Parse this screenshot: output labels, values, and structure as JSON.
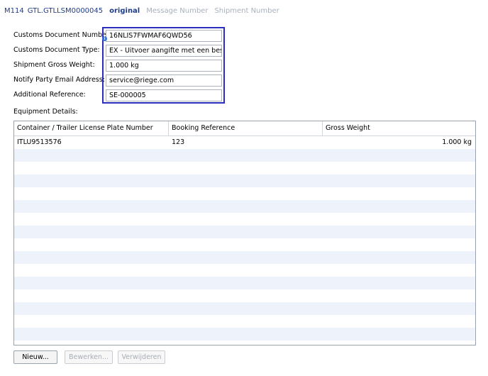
{
  "header": {
    "id": "M114",
    "doc_number": "GTL.GTLLSM0000045",
    "status": "original",
    "link_message": "Message Number",
    "link_shipment": "Shipment Number"
  },
  "form": {
    "customs_doc_number_label": "Customs Document Number:",
    "customs_doc_number_value": "16NLIS7FWMAF6QWD56",
    "customs_doc_type_label": "Customs Document Type:",
    "customs_doc_type_value": "EX - Uitvoer aangifte met een bestemm",
    "gross_weight_label": "Shipment Gross Weight:",
    "gross_weight_value": "1.000 kg",
    "notify_email_label": "Notify Party Email Address:",
    "notify_email_value": "service@riege.com",
    "additional_ref_label": "Additional Reference:",
    "additional_ref_value": "SE-000005"
  },
  "equipment": {
    "label": "Equipment Details:",
    "columns": [
      "Container / Trailer License Plate Number",
      "Booking Reference",
      "Gross Weight"
    ],
    "rows": [
      {
        "plate": "ITLU9513576",
        "booking": "123",
        "weight": "1.000 kg"
      }
    ]
  },
  "buttons": {
    "new": "Nieuw...",
    "edit": "Bewerken...",
    "delete": "Verwijderen"
  },
  "colors": {
    "accent_text": "#1f3c88",
    "focus_border": "#2b2dbf",
    "row_alt": "#eef2fb",
    "muted_link": "#a9b0bd"
  }
}
